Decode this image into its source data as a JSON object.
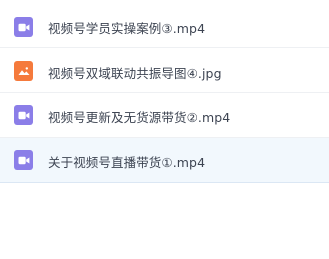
{
  "files": [
    {
      "name": "视频号学员实操案例③.mp4",
      "icon": "video-file-icon",
      "color": "#8b7ee8"
    },
    {
      "name": "视频号双域联动共振导图④.jpg",
      "icon": "image-file-icon",
      "color": "#f57a3c"
    },
    {
      "name": "视频号更新及无货源带货②.mp4",
      "icon": "video-file-icon",
      "color": "#8b7ee8"
    },
    {
      "name": "关于视频号直播带货①.mp4",
      "icon": "video-file-icon",
      "color": "#8b7ee8"
    }
  ],
  "selected_index": 3
}
